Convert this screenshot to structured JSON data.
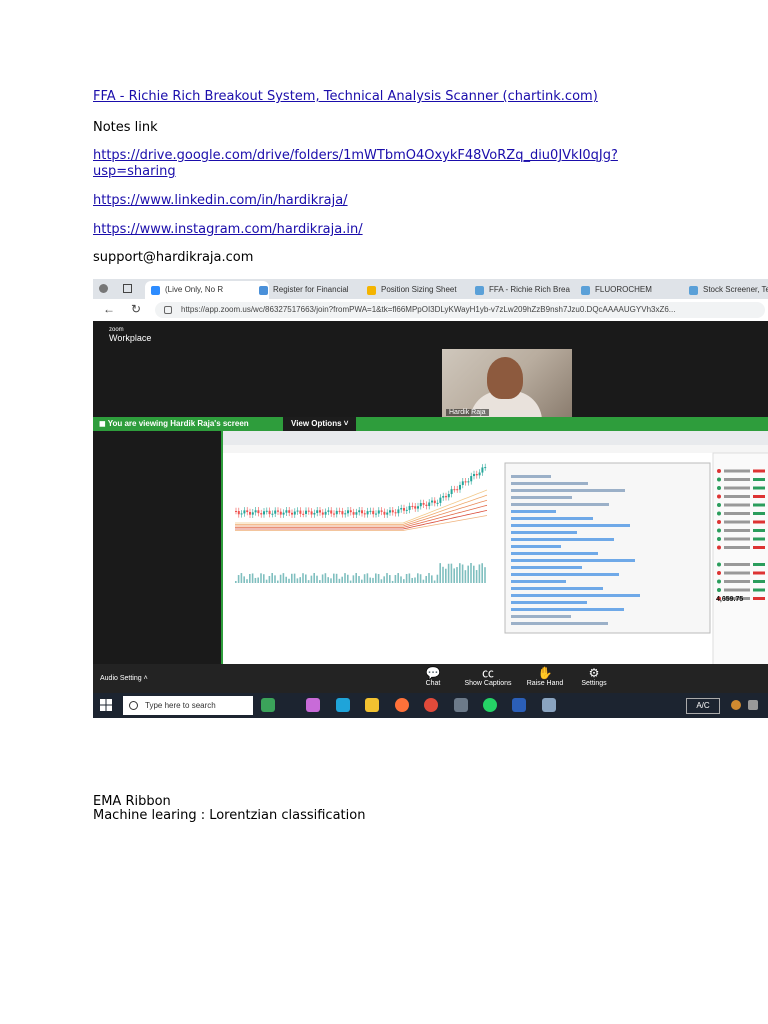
{
  "links": {
    "chartink": "FFA - Richie Rich Breakout System, Technical Analysis Scanner (chartink.com)",
    "notes_label": "Notes link",
    "drive_line1": "https://drive.google.com/drive/folders/1mWTbmO4OxykF48VoRZq_diu0JVkI0qJg?",
    "drive_line2": "usp=sharing",
    "linkedin": "https://www.linkedin.com/in/hardikraja/",
    "instagram": "https://www.instagram.com/hardikraja.in/",
    "email": "support@hardikraja.com"
  },
  "screenshot": {
    "tabs": [
      "(Live Only, No R",
      "Register for Financial",
      "Position Sizing Sheet",
      "FFA - Richie Rich Brea",
      "FLUOROCHEM",
      "Stock Screener, Tech"
    ],
    "url": "https://app.zoom.us/wc/86327517663/join?fromPWA=1&tk=fl66MPpOI3DLyKWayH1yb-v7zLw209hZzB9nsh7Jzu0.DQcAAAAUGYVh3xZ6...",
    "zoom_brand_small": "zoom",
    "zoom_brand": "Workplace",
    "camera_name": "Hardik Raja",
    "viewing_prefix": "You are viewing",
    "viewing_name": "Hardik Raja's screen",
    "view_options": "View Options",
    "audio_setting": "Audio Setting",
    "toolbar": [
      "Chat",
      "Show Captions",
      "Raise Hand",
      "Settings"
    ],
    "price": "4,659.75",
    "taskbar_search": "Type here to search",
    "tray_label": "A/C"
  },
  "notes": {
    "line1": "EMA Ribbon",
    "line2": "Machine learing : Lorentzian classification"
  }
}
